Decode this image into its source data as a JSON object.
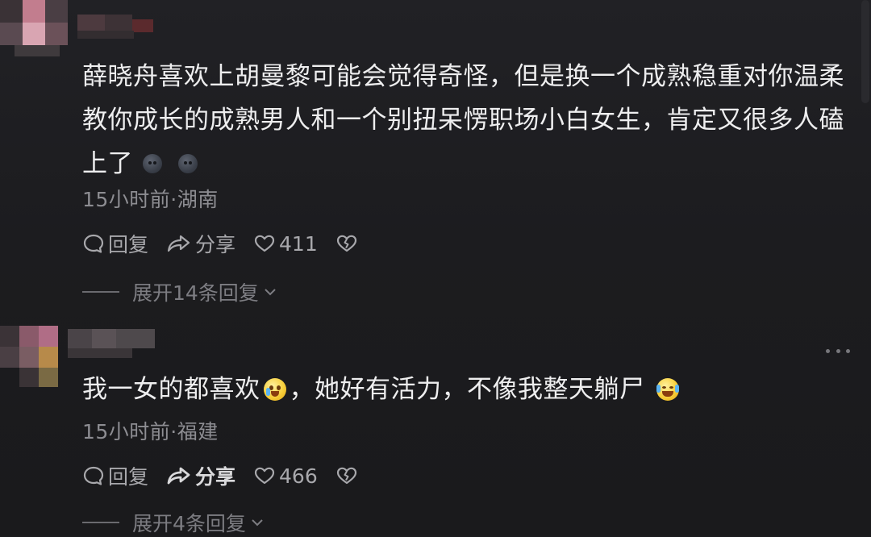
{
  "comments": [
    {
      "text_before_emoji": "薛晓舟喜欢上胡曼黎可能会觉得奇怪，但是换一个成熟稳重对你温柔教你成长的成熟男人和一个别扭呆愣职场小白女生，肯定又很多人磕上了",
      "emoji": [
        "dark-face-emoji",
        "dark-face-emoji"
      ],
      "meta": "15小时前·湖南",
      "actions": {
        "reply": "回复",
        "share": "分享",
        "likes": "411"
      },
      "expand": "展开14条回复"
    },
    {
      "text_part1": "我一女的都喜欢",
      "text_part2": "，她好有活力，不像我整天躺尸",
      "emoji": [
        "crying-face-emoji",
        "laughing-crying-emoji"
      ],
      "meta": "15小时前·福建",
      "actions": {
        "reply": "回复",
        "share": "分享",
        "likes": "466"
      },
      "expand": "展开4条回复"
    }
  ],
  "colors": {
    "background": "#1b1b1e",
    "text": "#eeeeef",
    "meta": "#8d8d92",
    "action": "#a8a8ac"
  }
}
